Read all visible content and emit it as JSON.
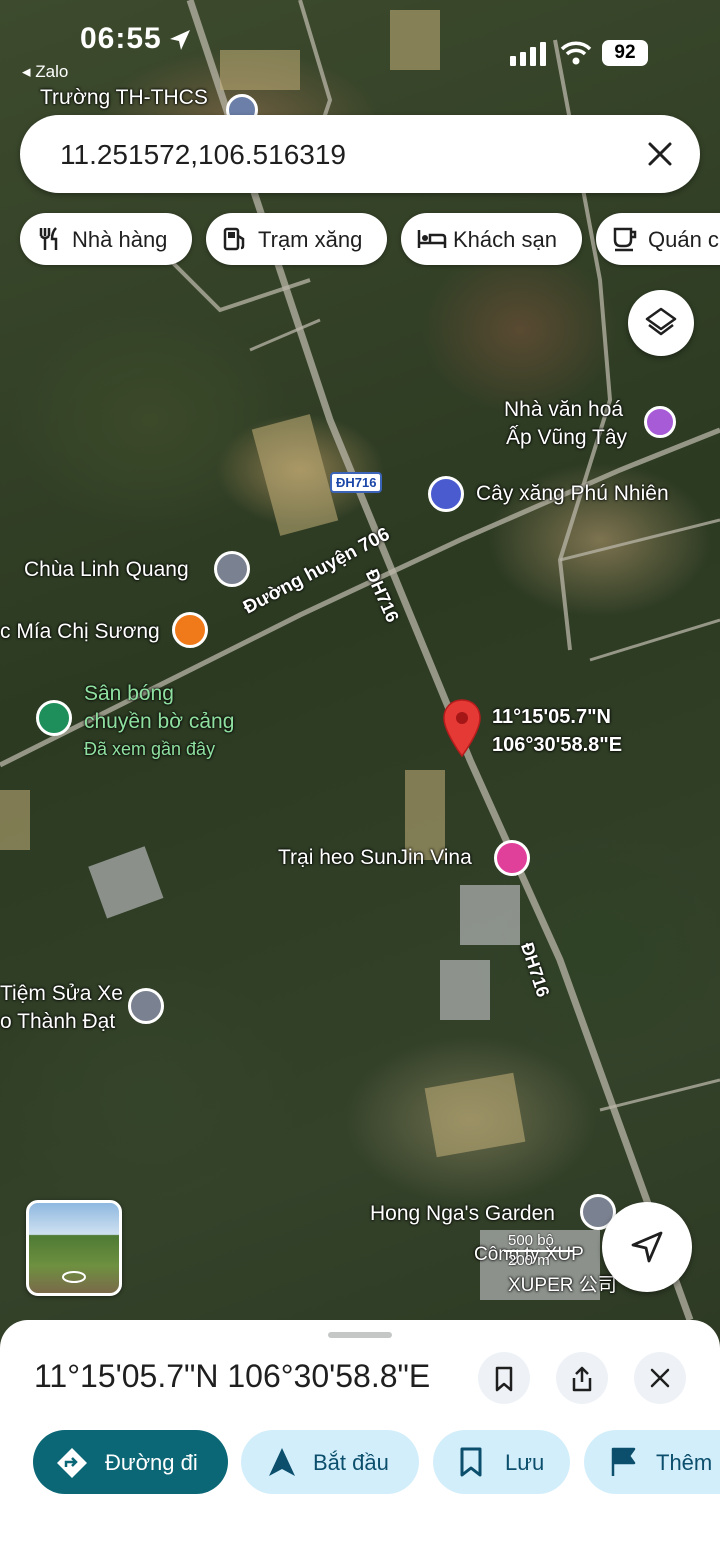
{
  "status_bar": {
    "time": "06:55",
    "back_app": "Zalo",
    "battery": "92"
  },
  "search": {
    "value": "11.251572,106.516319"
  },
  "chips": [
    {
      "label": "Nhà hàng",
      "icon": "restaurant-icon"
    },
    {
      "label": "Trạm xăng",
      "icon": "gas-station-icon"
    },
    {
      "label": "Khách sạn",
      "icon": "hotel-icon"
    },
    {
      "label": "Quán c",
      "icon": "coffee-icon"
    }
  ],
  "map": {
    "road_badge_top": "ĐH716",
    "road_label_706": "Đường huyện 706",
    "road_label_716a": "ĐH716",
    "road_label_716b": "ĐH716",
    "pin_lat": "11°15'05.7\"N",
    "pin_lng": "106°30'58.8\"E",
    "places": {
      "school": "Trường TH-THCS",
      "culture_house_line1": "Nhà văn hoá",
      "culture_house_line2": "Ấp Vũng Tây",
      "gas_station": "Cây xăng Phú Nhiên",
      "pagoda": "Chùa Linh Quang",
      "juice": "c Mía Chị Sương",
      "volleyball_line1": "Sân bóng",
      "volleyball_line2": "chuyền bờ cảng",
      "recently_viewed": "Đã xem gần đây",
      "pig_farm": "Trại heo SunJin Vina",
      "repair_line1": "Tiệm Sửa Xe",
      "repair_line2": "o Thành Đạt",
      "garden": "Hong Nga's Garden",
      "company_line1": "Công ty XUP",
      "company_line2": "XUPER 公司"
    },
    "scale_ft": "500 bộ",
    "scale_m": "200 m"
  },
  "sheet": {
    "title": "11°15'05.7\"N 106°30'58.8\"E",
    "actions": [
      {
        "label": "Đường đi"
      },
      {
        "label": "Bắt đầu"
      },
      {
        "label": "Lưu"
      },
      {
        "label": "Thêm"
      }
    ]
  },
  "colors": {
    "primary": "#0b6776",
    "tonal": "#d3eefb",
    "pin": "#e53935"
  }
}
